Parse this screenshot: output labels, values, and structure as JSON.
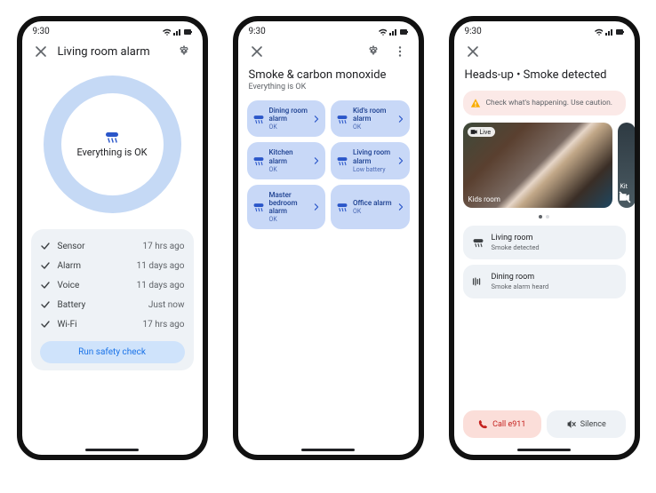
{
  "status_time": "9:30",
  "phone1": {
    "title": "Living room alarm",
    "status_msg": "Everything is OK",
    "rows": [
      {
        "label": "Sensor",
        "ts": "17 hrs ago"
      },
      {
        "label": "Alarm",
        "ts": "11 days ago"
      },
      {
        "label": "Voice",
        "ts": "11 days ago"
      },
      {
        "label": "Battery",
        "ts": "Just now"
      },
      {
        "label": "Wi-Fi",
        "ts": "17 hrs ago"
      }
    ],
    "run_label": "Run safety check"
  },
  "phone2": {
    "title": "Smoke & carbon monoxide",
    "subtitle": "Everything is OK",
    "tiles": [
      {
        "name": "Dining room alarm",
        "status": "OK"
      },
      {
        "name": "Kid's room alarm",
        "status": "OK"
      },
      {
        "name": "Kitchen alarm",
        "status": "OK"
      },
      {
        "name": "Living room alarm",
        "status": "Low battery"
      },
      {
        "name": "Master bedroom alarm",
        "status": "OK"
      },
      {
        "name": "Office alarm",
        "status": "OK"
      }
    ]
  },
  "phone3": {
    "title": "Heads-up • Smoke detected",
    "warning": "Check what's happening. Use caution.",
    "live_label": "Live",
    "cam_label": "Kids room",
    "cam_peek_label": "Kit",
    "alerts": [
      {
        "room": "Living room",
        "msg": "Smoke detected",
        "icon": "smoke"
      },
      {
        "room": "Dining room",
        "msg": "Smoke alarm heard",
        "icon": "sound"
      }
    ],
    "call_label": "Call e911",
    "silence_label": "Silence"
  }
}
